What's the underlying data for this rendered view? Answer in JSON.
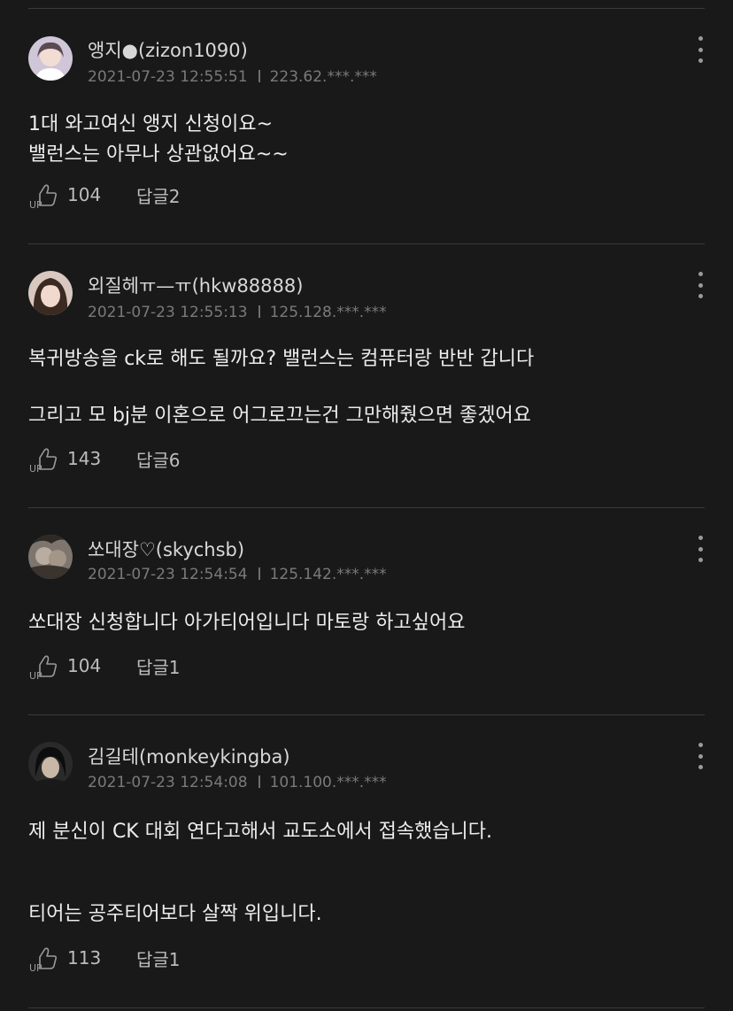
{
  "comments": [
    {
      "author": "앵지●(zizon1090)",
      "timestamp": "2021-07-23 12:55:51",
      "ip": "223.62.***.***",
      "lines": [
        "1대 와고여신 앵지 신청이요~",
        "밸런스는 아무나 상관없어요~~"
      ],
      "up_count": "104",
      "reply_label": "답글2"
    },
    {
      "author": "외질헤ㅠ—ㅠ(hkw88888)",
      "timestamp": "2021-07-23 12:55:13",
      "ip": "125.128.***.***",
      "lines": [
        "복귀방송을 ck로 해도 될까요? 밸런스는 컴퓨터랑 반반 갑니다",
        "그리고 모 bj분 이혼으로 어그로끄는건 그만해줬으면 좋겠어요"
      ],
      "up_count": "143",
      "reply_label": "답글6"
    },
    {
      "author": "쏘대장♡(skychsb)",
      "timestamp": "2021-07-23 12:54:54",
      "ip": "125.142.***.***",
      "lines": [
        "쏘대장 신청합니다 아가티어입니다 마토랑 하고싶어요"
      ],
      "up_count": "104",
      "reply_label": "답글1"
    },
    {
      "author": "김길테(monkeykingba)",
      "timestamp": "2021-07-23 12:54:08",
      "ip": "101.100.***.***",
      "lines": [
        "제 분신이 CK 대회 연다고해서 교도소에서 접속했습니다.",
        "티어는 공주티어보다 살짝 위입니다."
      ],
      "up_count": "113",
      "reply_label": "답글1"
    }
  ],
  "icons": {
    "like": "thumbs-up-icon",
    "more": "more-vertical-icon"
  },
  "colors": {
    "background": "#191919",
    "divider": "#3a3a3a",
    "text": "#ececec",
    "meta": "#7a7a7a"
  }
}
